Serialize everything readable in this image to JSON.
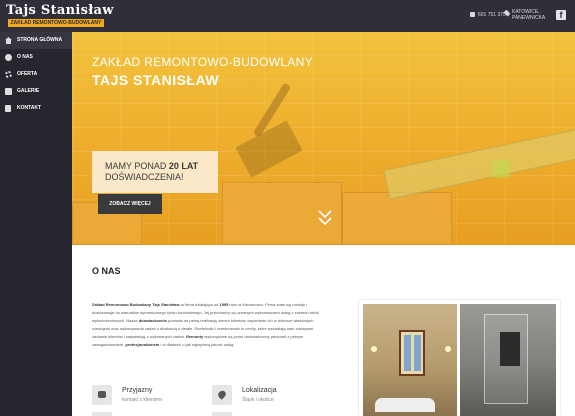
{
  "header": {
    "logo_main": "Tajs Stanisław",
    "logo_sub": "ZAKŁAD REMONTOWO-BUDOWLANY",
    "phone": "601 751 375",
    "location_line1": "KATOWICE,",
    "location_line2": "PANEWNICKA",
    "facebook": "f"
  },
  "sidebar": {
    "items": [
      {
        "label": "STRONA GŁÓWNA",
        "icon": "home-icon"
      },
      {
        "label": "O NAS",
        "icon": "info-icon"
      },
      {
        "label": "OFERTA",
        "icon": "gear-icon"
      },
      {
        "label": "GALERIE",
        "icon": "gallery-icon"
      },
      {
        "label": "KONTAKT",
        "icon": "contact-icon"
      }
    ]
  },
  "hero": {
    "title_line1": "ZAKŁAD REMONTOWO-BUDOWLANY",
    "title_line2": "TAJS STANISŁAW",
    "exp_prefix": "MAMY PONAD ",
    "exp_bold": "20 LAT",
    "exp_line2": "DOŚWIADCZENIA!",
    "button": "ZOBACZ WIĘCEJ",
    "scroll_icon": "chevron-down-icon"
  },
  "about": {
    "title": "O NAS",
    "company": "Zakład Remontowo Budowlany Tajs Stanisław",
    "text1": " to firma działająca od ",
    "year": "1995",
    "text2": " roku w Katowicach. Firma stale się rozwija i dostosowuje do warunków dynamicznego rynku budowlanego. Jej pracownicy są uznanymi wykonawcami usług z zakresu robót wykończeniowych. Nasze ",
    "bold2": "doświadczenie",
    "text3": " pozwala na pełną realizację zleceń klientów, wspieranie ich w doborze właściwych rozwiązań oraz wykonywaniu zadań z dbałością o detale. Rzetelność i terminowość to cechy, które pozwalają nam zdobywać zaufanie klientów i satysfakcję z wykonanych zadań. ",
    "bold3": "Remonty",
    "text4": " wykonywane są przez doświadczony personel z pełnym zaangażowaniem, ",
    "bold4": "profesjonalizmem",
    "text5": " i w dbałości o jak najwyższą jakość usług.",
    "features": [
      {
        "title": "Przyjazny",
        "subtitle": "kontakt z klientem",
        "icon": "chat-icon"
      },
      {
        "title": "Lokalizacja",
        "subtitle": "Śląsk i okolice",
        "icon": "location-pin-icon"
      }
    ]
  }
}
